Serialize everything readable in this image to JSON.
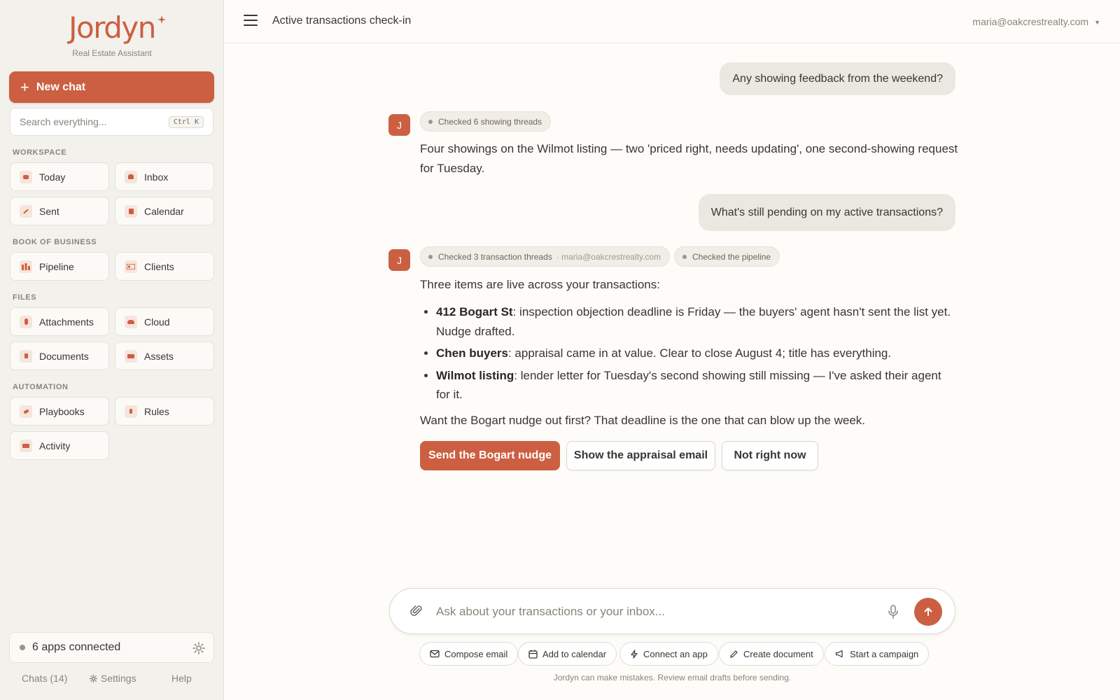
{
  "brand": {
    "name": "Jordyn",
    "tagline": "Real Estate Assistant",
    "accent_color": "#cc5f42"
  },
  "sidebar": {
    "new_chat_label": "New chat",
    "search": {
      "placeholder": "Search everything...",
      "shortcut": "Ctrl K"
    },
    "sections": {
      "workspace": "WORKSPACE",
      "book_of_business": "BOOK OF BUSINESS",
      "files": "FILES",
      "automation": "AUTOMATION"
    },
    "items": {
      "today": "Today",
      "inbox": "Inbox",
      "sent": "Sent",
      "calendar": "Calendar",
      "pipeline": "Pipeline",
      "clients": "Clients",
      "attachments": "Attachments",
      "cloud": "Cloud",
      "documents": "Documents",
      "assets": "Assets",
      "playbooks": "Playbooks",
      "rules": "Rules",
      "activity": "Activity"
    },
    "apps_connected": "6 apps connected",
    "footer": {
      "chats": "Chats (14)",
      "settings": "Settings",
      "help": "Help"
    }
  },
  "header": {
    "title": "Active transactions check-in",
    "account": "maria@oakcrestrealty.com"
  },
  "conversation": {
    "user_1": "Any showing feedback from the weekend?",
    "assistant_initial": "J",
    "assistant_1": {
      "chip": "Checked 6 showing threads",
      "text": "Four showings on the Wilmot listing — two 'priced right, needs updating', one second-showing request for Tuesday."
    },
    "user_2": "What's still pending on my active transactions?",
    "assistant_2": {
      "chip_1": "Checked 3 transaction threads",
      "chip_1_source": "· maria@oakcrestrealty.com",
      "chip_2": "Checked the pipeline",
      "intro": "Three items are live across your transactions:",
      "bullets": [
        {
          "title": "412 Bogart St",
          "text": ": inspection objection deadline is Friday — the buyers' agent hasn't sent the list yet. Nudge drafted."
        },
        {
          "title": "Chen buyers",
          "text": ": appraisal came in at value. Clear to close August 4; title has everything."
        },
        {
          "title": "Wilmot listing",
          "text": ": lender letter for Tuesday's second showing still missing — I've asked their agent for it."
        }
      ],
      "outro": "Want the Bogart nudge out first? That deadline is the one that can blow up the week.",
      "actions": {
        "primary": "Send the Bogart nudge",
        "secondary_1": "Show the appraisal email",
        "secondary_2": "Not right now"
      }
    }
  },
  "composer": {
    "placeholder": "Ask about your transactions or your inbox...",
    "quick_actions": {
      "compose": "Compose email",
      "calendar": "Add to calendar",
      "connect": "Connect an app",
      "document": "Create document",
      "campaign": "Start a campaign"
    },
    "disclaimer": "Jordyn can make mistakes. Review email drafts before sending."
  }
}
